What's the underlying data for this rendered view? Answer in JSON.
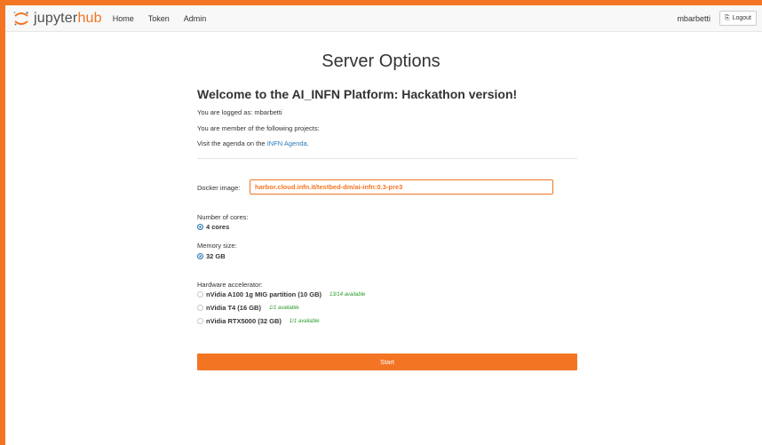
{
  "brand": {
    "name_part1": "jupyter",
    "name_part2": "hub",
    "accent": "#f37524"
  },
  "nav": {
    "links": [
      {
        "label": "Home"
      },
      {
        "label": "Token"
      },
      {
        "label": "Admin"
      }
    ],
    "username": "mbarbetti",
    "logout_label": "Logout",
    "logout_icon": "sign-out-icon"
  },
  "page": {
    "title": "Server Options",
    "welcome": "Welcome to the AI_INFN Platform: Hackathon version!",
    "logged_as": "You are logged as: mbarbetti",
    "projects": "You are member of the following projects:",
    "agenda_prefix": "Visit the agenda on the ",
    "agenda_link": "INFN Agenda",
    "agenda_suffix": "."
  },
  "form": {
    "docker_label": "Docker image:",
    "docker_value": "harbor.cloud.infn.it/testbed-dm/ai-infn:0.3-pre3",
    "cores_label": "Number of cores:",
    "cores_option": "4 cores",
    "memory_label": "Memory size:",
    "memory_option": "32 GB",
    "accel_label": "Hardware accelerator:",
    "accelerators": [
      {
        "label": "nVidia A100 1g MIG partition (10 GB)",
        "availability": "13/14 available",
        "checked": false
      },
      {
        "label": "nVidia T4 (16 GB)",
        "availability": "1/1 available",
        "checked": false
      },
      {
        "label": "nVidia RTX5000 (32 GB)",
        "availability": "1/1 available",
        "checked": false
      }
    ],
    "start_label": "Start"
  },
  "colors": {
    "accent": "#f37524",
    "link": "#2a7ab8",
    "available": "#2a9a2a"
  }
}
